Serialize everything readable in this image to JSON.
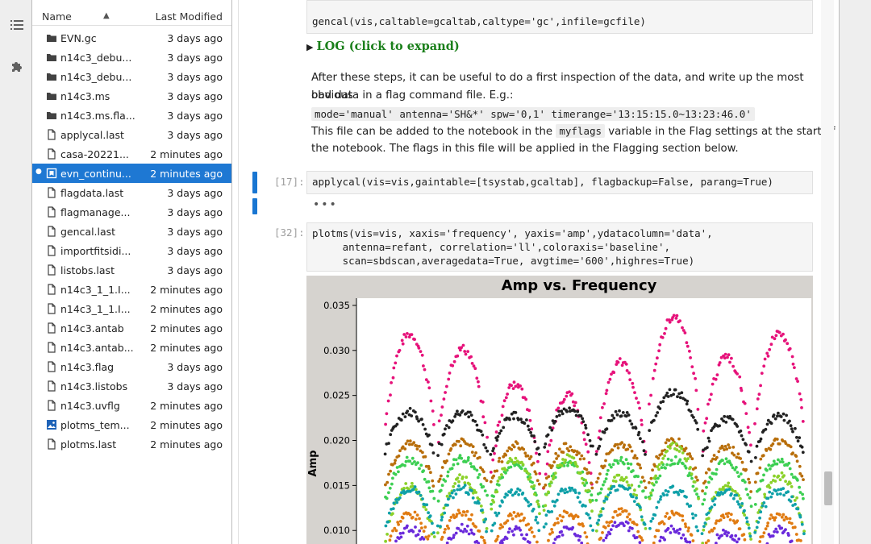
{
  "activity_bar": {
    "icons": [
      "list-icon",
      "puzzle-icon"
    ]
  },
  "file_browser": {
    "header": {
      "name": "Name",
      "last_modified": "Last Modified"
    },
    "files": [
      {
        "name": "EVN.gc",
        "date": "3 days ago",
        "icon": "folder"
      },
      {
        "name": "n14c3_debu...",
        "date": "3 days ago",
        "icon": "folder"
      },
      {
        "name": "n14c3_debu...",
        "date": "3 days ago",
        "icon": "folder"
      },
      {
        "name": "n14c3.ms",
        "date": "3 days ago",
        "icon": "folder"
      },
      {
        "name": "n14c3.ms.fla...",
        "date": "3 days ago",
        "icon": "folder"
      },
      {
        "name": "applycal.last",
        "date": "3 days ago",
        "icon": "file"
      },
      {
        "name": "casa-20221...",
        "date": "2 minutes ago",
        "icon": "file"
      },
      {
        "name": "evn_continu...",
        "date": "2 minutes ago",
        "icon": "notebook",
        "selected": true
      },
      {
        "name": "flagdata.last",
        "date": "3 days ago",
        "icon": "file"
      },
      {
        "name": "flagmanage...",
        "date": "3 days ago",
        "icon": "file"
      },
      {
        "name": "gencal.last",
        "date": "3 days ago",
        "icon": "file"
      },
      {
        "name": "importfitsidi...",
        "date": "3 days ago",
        "icon": "file"
      },
      {
        "name": "listobs.last",
        "date": "3 days ago",
        "icon": "file"
      },
      {
        "name": "n14c3_1_1.I...",
        "date": "2 minutes ago",
        "icon": "file"
      },
      {
        "name": "n14c3_1_1.I...",
        "date": "2 minutes ago",
        "icon": "file"
      },
      {
        "name": "n14c3.antab",
        "date": "2 minutes ago",
        "icon": "file"
      },
      {
        "name": "n14c3.antab...",
        "date": "2 minutes ago",
        "icon": "file"
      },
      {
        "name": "n14c3.flag",
        "date": "3 days ago",
        "icon": "file"
      },
      {
        "name": "n14c3.listobs",
        "date": "3 days ago",
        "icon": "file"
      },
      {
        "name": "n14c3.uvflg",
        "date": "2 minutes ago",
        "icon": "file"
      },
      {
        "name": "plotms_tem...",
        "date": "2 minutes ago",
        "icon": "image"
      },
      {
        "name": "plotms.last",
        "date": "2 minutes ago",
        "icon": "file"
      }
    ]
  },
  "notebook": {
    "gencal_code": "gencal(vis,caltable=gcaltab,caltype='gc',infile=gcfile)",
    "log_toggle": "LOG (click to expand)",
    "md_line1": "After these steps, it can be useful to do a first inspection of the data, and write up the most obvious",
    "md_line2": "bad data in a flag command file. E.g.:",
    "md_code": "mode='manual' antenna='SH&*' spw='0,1' timerange='13:15:15.0~13:23:46.0'",
    "md_line3a": "This file can be added to the notebook in the",
    "md_line3_code": "myflags",
    "md_line3b": "variable in the Flag settings at the start of",
    "md_line4": "the notebook. The flags in this file will be applied in the Flagging section below.",
    "cell17_prompt": "[17]:",
    "cell17_code": "applycal(vis=vis,gaintable=[tsystab,gcaltab], flagbackup=False, parang=True)",
    "ellipsis": "•••",
    "cell32_prompt": "[32]:",
    "cell32_code": "plotms(vis=vis, xaxis='frequency', yaxis='amp',ydatacolumn='data',\n     antenna=refant, correlation='ll',coloraxis='baseline',\n     scan=sbdscan,averagedata=True, avgtime='600',highres=True)"
  },
  "chart_data": {
    "type": "scatter",
    "title": "Amp vs. Frequency",
    "ylabel": "Amp",
    "xlabel": "",
    "y_ticks": [
      "0.035",
      "0.030",
      "0.025",
      "0.020",
      "0.015",
      "0.010"
    ],
    "ylim": [
      0.0085,
      0.0358
    ],
    "spw_count": 8,
    "series": [
      {
        "color": "#e6127a",
        "peaks": [
          0.0318,
          0.0302,
          0.0262,
          0.025,
          0.0287,
          0.0338,
          0.0292,
          0.0318
        ]
      },
      {
        "color": "#222222",
        "peaks": [
          0.0232,
          0.0232,
          0.0228,
          0.0236,
          0.023,
          0.0254,
          0.0224,
          0.0228
        ]
      },
      {
        "color": "#b86e0a",
        "peaks": [
          0.0196,
          0.0198,
          0.0195,
          0.0193,
          0.0196,
          0.02,
          0.0192,
          0.02
        ]
      },
      {
        "color": "#3ccf52",
        "peaks": [
          0.0178,
          0.018,
          0.0174,
          0.0175,
          0.0178,
          0.0178,
          0.0176,
          0.0178
        ]
      },
      {
        "color": "#8bd12a",
        "peaks": [
          0.015,
          0.0158,
          0.018,
          0.018,
          0.016,
          0.0195,
          0.015,
          0.016
        ]
      },
      {
        "color": "#0fa0a8",
        "peaks": [
          0.0147,
          0.0147,
          0.0144,
          0.0146,
          0.015,
          0.0146,
          0.0143,
          0.0145
        ]
      },
      {
        "color": "#e07b12",
        "peaks": [
          0.0118,
          0.012,
          0.0117,
          0.0118,
          0.0121,
          0.0118,
          0.0116,
          0.0118
        ]
      },
      {
        "color": "#6a2adb",
        "peaks": [
          0.0102,
          0.0103,
          0.01,
          0.0101,
          0.0108,
          0.0101,
          0.0098,
          0.0101
        ]
      }
    ]
  }
}
